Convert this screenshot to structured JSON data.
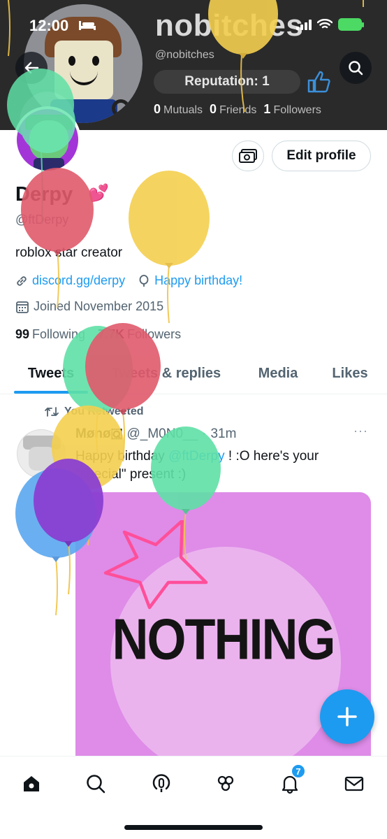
{
  "status_bar": {
    "time": "12:00"
  },
  "banner": {
    "display_name": "nobitches",
    "handle": "@nobitches",
    "reputation": "Reputation: 1",
    "stats": [
      {
        "value": "0",
        "label": "Mutuals"
      },
      {
        "value": "0",
        "label": "Friends"
      },
      {
        "value": "1",
        "label": "Followers"
      }
    ]
  },
  "profile": {
    "display_name": "Derpy",
    "hearts": "💕",
    "handle": "@ftDerpy",
    "bio": "roblox star creator",
    "link": "discord.gg/derpy",
    "birthday": "Happy birthday!",
    "joined": "Joined November 2015",
    "following_count": "99",
    "following_label": "Following",
    "followers_count": "7.7K",
    "followers_label": "Followers",
    "edit_button": "Edit profile"
  },
  "tabs": [
    {
      "label": "Tweets",
      "active": true
    },
    {
      "label": "Tweets & replies",
      "active": false
    },
    {
      "label": "Media",
      "active": false
    },
    {
      "label": "Likes",
      "active": false
    }
  ],
  "tweet": {
    "retweet_label": "You Retweeted",
    "author": "Mønø🇶",
    "handle": "@_M0N0__",
    "separator": "·",
    "time": "31m",
    "more": "···",
    "text_before": "Happy birthday ",
    "mention": "@ftDerpy",
    "text_after": " ! :O here's your \"special\" present :)",
    "media_text": "NOTHING"
  },
  "bottom_nav": {
    "notification_count": "7"
  },
  "colors": {
    "accent": "#1d9bf0",
    "media_bg": "#de8ce8",
    "balloon_red": "#e05a6b",
    "balloon_yellow": "#f4cf4f",
    "balloon_green": "#5fe0a6",
    "balloon_blue": "#5aa7f0",
    "balloon_purple": "#8a3fd1"
  }
}
